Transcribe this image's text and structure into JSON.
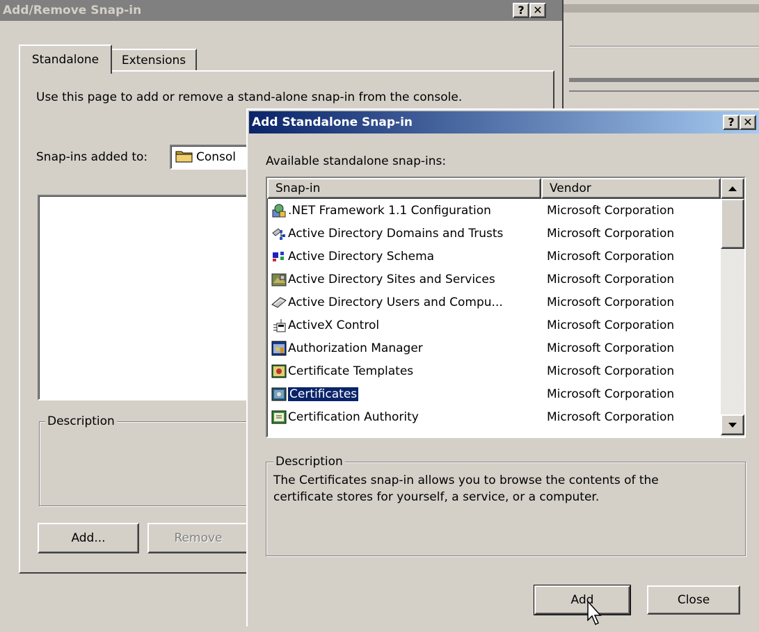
{
  "back_dialog": {
    "title": "Add/Remove Snap-in",
    "help_glyph": "?",
    "close_glyph": "✕",
    "tabs": [
      {
        "label": "Standalone",
        "active": true
      },
      {
        "label": "Extensions",
        "active": false
      }
    ],
    "intro_text": "Use this page to add or remove a stand-alone snap-in from the console.",
    "added_to_label": "Snap-ins added to:",
    "added_to_value": "Consol",
    "description_label": "Description",
    "add_button": "Add...",
    "remove_button": "Remove"
  },
  "front_dialog": {
    "title": "Add Standalone Snap-in",
    "help_glyph": "?",
    "close_glyph": "✕",
    "available_label": "Available standalone snap-ins:",
    "columns": {
      "snapin": "Snap-in",
      "vendor": "Vendor"
    },
    "rows": [
      {
        "name": ".NET Framework 1.1 Configuration",
        "vendor": "Microsoft Corporation",
        "icon": "net-framework-icon"
      },
      {
        "name": "Active Directory Domains and Trusts",
        "vendor": "Microsoft Corporation",
        "icon": "domains-trusts-icon"
      },
      {
        "name": "Active Directory Schema",
        "vendor": "Microsoft Corporation",
        "icon": "schema-icon"
      },
      {
        "name": "Active Directory Sites and Services",
        "vendor": "Microsoft Corporation",
        "icon": "sites-services-icon"
      },
      {
        "name": "Active Directory Users and Compu...",
        "vendor": "Microsoft Corporation",
        "icon": "users-computers-icon"
      },
      {
        "name": "ActiveX Control",
        "vendor": "Microsoft Corporation",
        "icon": "activex-icon"
      },
      {
        "name": "Authorization Manager",
        "vendor": "Microsoft Corporation",
        "icon": "authorization-manager-icon"
      },
      {
        "name": "Certificate Templates",
        "vendor": "Microsoft Corporation",
        "icon": "certificate-templates-icon"
      },
      {
        "name": "Certificates",
        "vendor": "Microsoft Corporation",
        "icon": "certificates-icon",
        "selected": true
      },
      {
        "name": "Certification Authority",
        "vendor": "Microsoft Corporation",
        "icon": "certification-authority-icon"
      }
    ],
    "description_label": "Description",
    "description_text": "The Certificates snap-in allows you to browse the contents of the certificate stores for yourself, a service, or a computer.",
    "add_button": "Add",
    "close_button": "Close"
  },
  "colors": {
    "face": "#d4d0c8",
    "title_active_start": "#0a246a",
    "title_active_end": "#a6caf0",
    "title_inactive": "#808080",
    "selection": "#0a246a"
  }
}
